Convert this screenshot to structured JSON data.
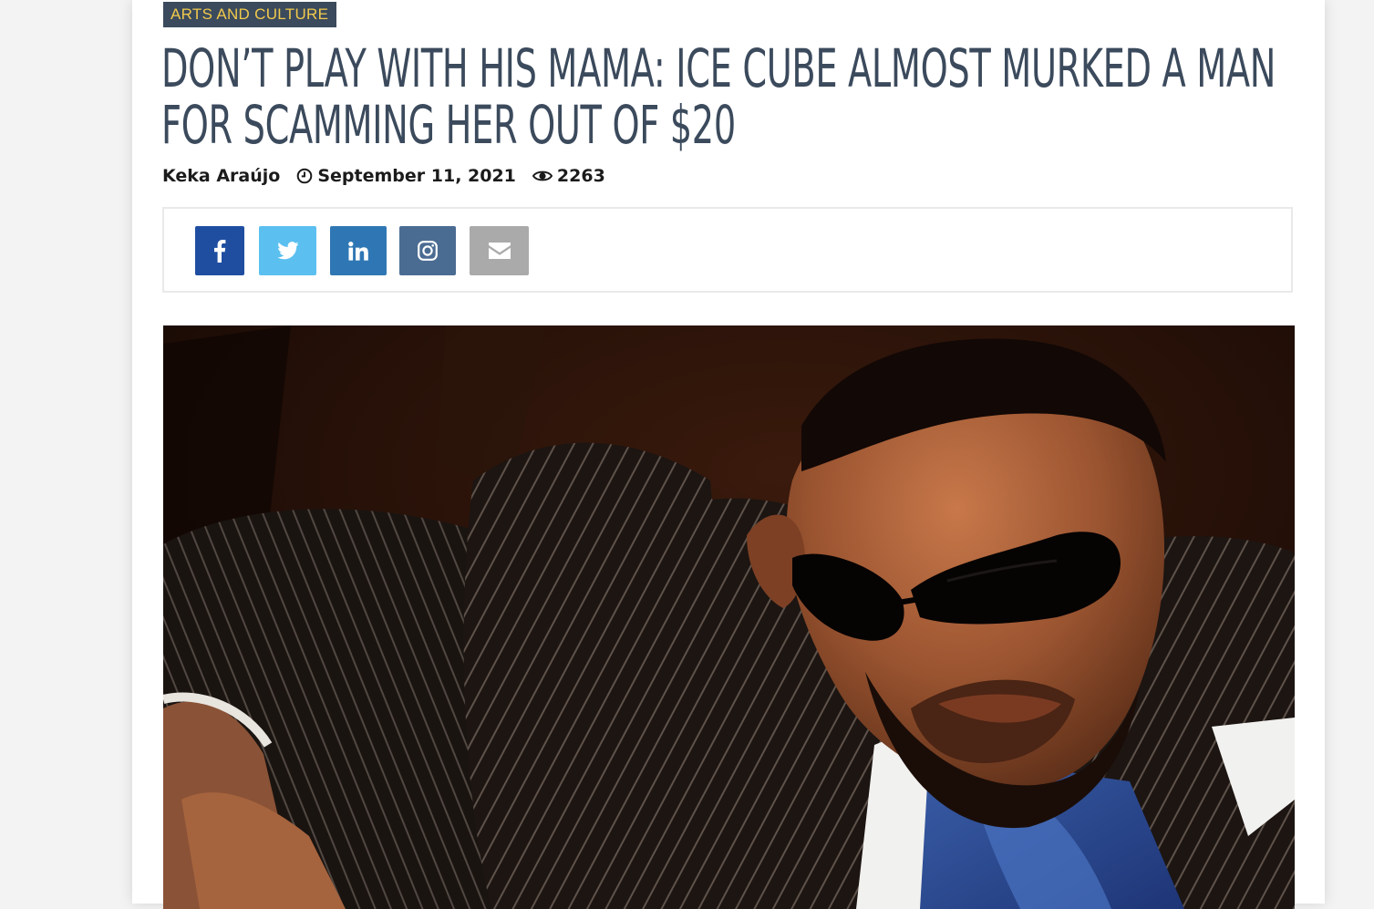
{
  "article": {
    "category": "ARTS AND CULTURE",
    "headline_line1": "DON’T PLAY WITH HIS MAMA: ICE CUBE ALMOST MURKED A MAN",
    "headline_line2": "FOR SCAMMING HER OUT OF $20",
    "author": "Keka Araújo",
    "date": "September 11, 2021",
    "views": "2263",
    "icons": {
      "date": "clock-icon",
      "views": "eye-icon"
    }
  },
  "share": {
    "buttons": [
      {
        "name": "facebook",
        "icon": "facebook-icon",
        "color": "#1f4ea1"
      },
      {
        "name": "twitter",
        "icon": "twitter-icon",
        "color": "#5bc0f0"
      },
      {
        "name": "linkedin",
        "icon": "linkedin-icon",
        "color": "#2f77b4"
      },
      {
        "name": "instagram",
        "icon": "instagram-icon",
        "color": "#4a6c92"
      },
      {
        "name": "email",
        "icon": "email-icon",
        "color": "#aaaaaa"
      }
    ]
  },
  "colors": {
    "accent_dark": "#3b4a5c",
    "category_text": "#f2c94c",
    "page_bg": "#f3f3f3"
  }
}
